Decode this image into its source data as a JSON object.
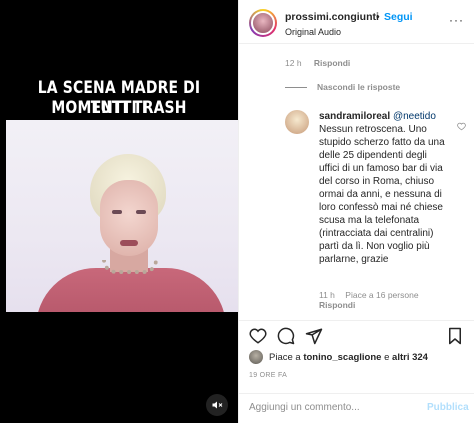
{
  "video": {
    "caption_line1": "LA SCENA MADRE DI TUTTI I",
    "caption_line2": "MOMENTI TRASH",
    "icons": [
      "mute-icon"
    ]
  },
  "post": {
    "username": "prossimi.congiunti",
    "separator": "•",
    "follow_label": "Segui",
    "audio_label": "Original Audio",
    "more_label": "···"
  },
  "previous_comment_meta": {
    "time": "12 h",
    "reply_label": "Rispondi"
  },
  "hide_replies_label": "Nascondi le risposte",
  "reply": {
    "username": "sandramiloreal",
    "mention": "@neetido",
    "text": "Nessun retroscena. Uno stupido scherzo fatto da una delle 25 dipendenti degli uffici di un famoso bar di via del corso in Roma, chiuso ormai da anni, e nessuna di loro confessò mai né chiese scusa ma la telefonata (rintracciata dai centralini) partì da lì. Non voglio più parlarne, grazie",
    "time": "11 h",
    "likes": "Piace a 16 persone",
    "reply_label": "Rispondi"
  },
  "likes": {
    "prefix": "Piace a",
    "user": "tonino_scaglione",
    "conj": "e",
    "others": "altri 324"
  },
  "timestamp": "19 ORE FA",
  "comment_box": {
    "placeholder": "Aggiungi un commento...",
    "publish_label": "Pubblica"
  },
  "colors": {
    "accent": "#0095f6",
    "publish_disabled": "#b2dffc",
    "muted_text": "#8e8e8e",
    "mention": "#00376b"
  }
}
